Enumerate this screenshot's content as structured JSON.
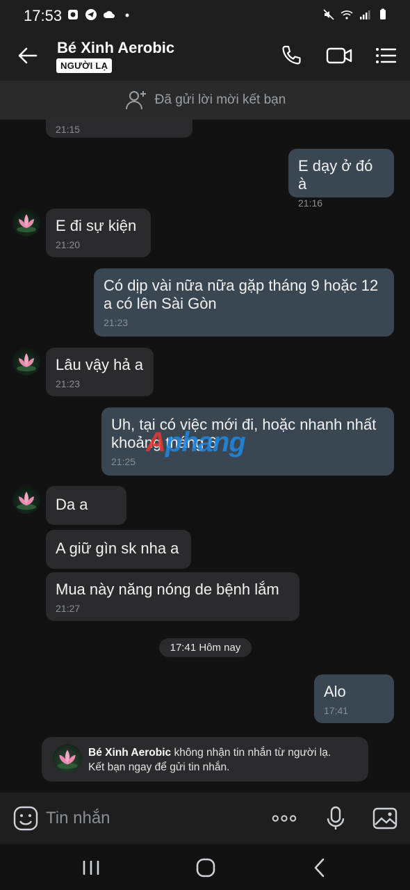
{
  "status_bar": {
    "time": "17:53"
  },
  "header": {
    "contact_name": "Bé Xinh Aerobic",
    "badge": "NGƯỜI LẠ"
  },
  "friend_banner": {
    "text": "Đã gửi lời mời kết bạn"
  },
  "messages": [
    {
      "dir": "in",
      "text": "",
      "time": "21:15"
    },
    {
      "dir": "out",
      "text": "E dạy ở đó à",
      "time": "21:16"
    },
    {
      "dir": "in",
      "text": "E đi sự kiện",
      "time": "21:20"
    },
    {
      "dir": "out",
      "text": "Có dịp vài nữa nữa gặp tháng 9 hoặc 12\na có lên Sài Gòn",
      "time": "21:23"
    },
    {
      "dir": "in",
      "text": "Lâu vậy hả a",
      "time": "21:23"
    },
    {
      "dir": "out",
      "text": "Uh, tại có việc mới đi, hoặc nhanh nhất\nkhoảng tháng 6",
      "time": "21:25"
    },
    {
      "dir": "in",
      "text": "Da a",
      "time": ""
    },
    {
      "dir": "in",
      "text": "A giữ gìn sk nha a",
      "time": ""
    },
    {
      "dir": "in",
      "text": "Mua này năng nóng de bệnh lắm",
      "time": "21:27"
    },
    {
      "dir": "out",
      "text": "Alo",
      "time": "17:41"
    }
  ],
  "day_separator": "17:41 Hôm nay",
  "notice": {
    "name": "Bé Xinh Aerobic",
    "text_after_name": " không nhận tin nhắn từ người lạ.",
    "line2": "Kết bạn ngay để gửi tin nhắn."
  },
  "watermark": {
    "part1": "A",
    "part2": "phang"
  },
  "input": {
    "placeholder": "Tin nhắn"
  },
  "colors": {
    "bg": "#121212",
    "bubble_in": "#2b2b2d",
    "bubble_out": "#3a4651",
    "time": "#8a8f94"
  },
  "icons": [
    "back-arrow-icon",
    "phone-icon",
    "video-icon",
    "menu-icon",
    "add-friend-icon",
    "sticker-icon",
    "more-icon",
    "mic-icon",
    "image-icon"
  ]
}
